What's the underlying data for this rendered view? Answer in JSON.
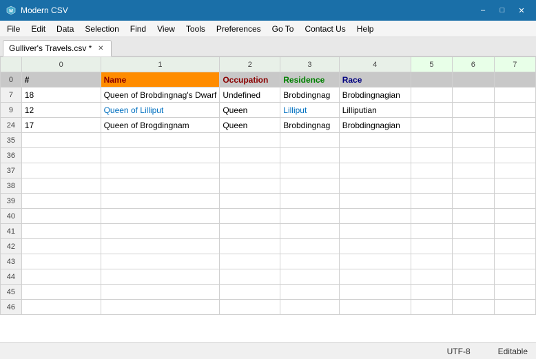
{
  "titleBar": {
    "title": "Modern CSV",
    "minimize": "–",
    "maximize": "□",
    "close": "✕"
  },
  "menuBar": {
    "items": [
      "File",
      "Edit",
      "Data",
      "Selection",
      "Find",
      "View",
      "Tools",
      "Preferences",
      "Go To",
      "Contact Us",
      "Help"
    ]
  },
  "tab": {
    "label": "Gulliver's Travels.csv",
    "modified": true
  },
  "columns": {
    "rowHeader": "",
    "headers": [
      "0",
      "1",
      "2",
      "3",
      "4",
      "5",
      "6",
      "7"
    ]
  },
  "rows": [
    {
      "rowNum": "0",
      "cells": [
        "#",
        "Name",
        "Occupation",
        "Residence",
        "Race",
        "",
        "",
        ""
      ]
    },
    {
      "rowNum": "7",
      "cells": [
        "18",
        "Queen of Brobdingnag's Dwarf",
        "Undefined",
        "Brobdingnag",
        "Brobdingnagian",
        "",
        "",
        ""
      ]
    },
    {
      "rowNum": "9",
      "cells": [
        "12",
        "Queen of Lilliput",
        "Queen",
        "Lilliput",
        "Lilliputian",
        "",
        "",
        ""
      ]
    },
    {
      "rowNum": "24",
      "cells": [
        "17",
        "Queen of Brogdingnam",
        "Queen",
        "Brobdingnag",
        "Brobdingnagian",
        "",
        "",
        ""
      ]
    }
  ],
  "emptyRows": [
    "35",
    "36",
    "37",
    "38",
    "39",
    "40",
    "41",
    "42",
    "43",
    "44",
    "45",
    "46"
  ],
  "statusBar": {
    "encoding": "UTF-8",
    "mode": "Editable"
  }
}
